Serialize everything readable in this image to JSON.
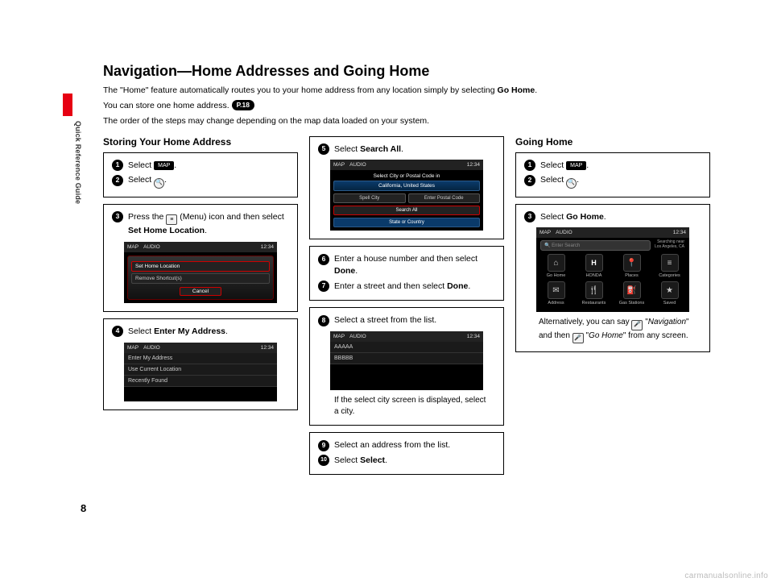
{
  "page_number": "8",
  "side_label": "Quick Reference Guide",
  "footer_brand": "carmanualsonline.info",
  "title": "Navigation—Home Addresses and Going Home",
  "intro_line1_a": "The \"Home\" feature automatically routes you to your home address from any location simply by selecting ",
  "intro_line1_b": "Go Home",
  "intro_line1_c": ".",
  "intro_line2": "You can store one home address. ",
  "p18_label": "P.18",
  "intro_line3": "The order of the steps may change depending on the map data loaded on your system.",
  "col1_heading": "Storing Your Home Address",
  "col3_heading": "Going Home",
  "map_button_label": "MAP",
  "clock": "12:34",
  "screen_tab_map": "MAP",
  "screen_tab_audio": "AUDIO",
  "storing": {
    "step1": "Select ",
    "step2": "Select ",
    "step3_a": "Press the ",
    "step3_b": " (Menu) icon and then select ",
    "step3_c": "Set Home Location",
    "step4_a": "Select ",
    "step4_b": "Enter My Address",
    "step5_a": "Select ",
    "step5_b": "Search All",
    "step6_a": "Enter a house number and then select ",
    "step6_b": "Done",
    "step7_a": "Enter a street and then select ",
    "step7_b": "Done",
    "step8": "Select a street from the list.",
    "step8_note": "If the select city screen is displayed, select a city.",
    "step9": "Select an address from the list.",
    "step10_a": "Select ",
    "step10_b": "Select"
  },
  "going": {
    "step1": "Select ",
    "step2": "Select ",
    "step3_a": "Select ",
    "step3_b": "Go Home",
    "note_a": "Alternatively, you can say ",
    "note_b": " \"",
    "note_c": "Navigation",
    "note_d": "\" and then ",
    "note_e": " \"",
    "note_f": "Go Home",
    "note_g": "\" from any screen."
  },
  "screens": {
    "menu": {
      "row1": "Set Home Location",
      "row2": "Remove Shortcut(s)",
      "cancel": "Cancel"
    },
    "enter_addr": {
      "row1": "Enter My Address",
      "row2": "Use Current Location",
      "row3": "Recently Found"
    },
    "search_all": {
      "header": "Select City or Postal Code in",
      "band": "California, United States",
      "spell_city": "Spell City",
      "enter_postal": "Enter Postal Code",
      "search_all": "Search All",
      "state": "State or Country"
    },
    "street_list": {
      "row1": "AAAAA",
      "row2": "BBBBB"
    },
    "gohome": {
      "enter_search": "Enter Search",
      "searching_near": "Searching near",
      "location": "Los Angeles, CA",
      "item1": "Go Home",
      "item2": "HONDA",
      "item3": "Places",
      "item4": "Categories",
      "item5": "Address",
      "item6": "Restaurants",
      "item7": "Gas Stations",
      "item8": "Saved"
    }
  }
}
